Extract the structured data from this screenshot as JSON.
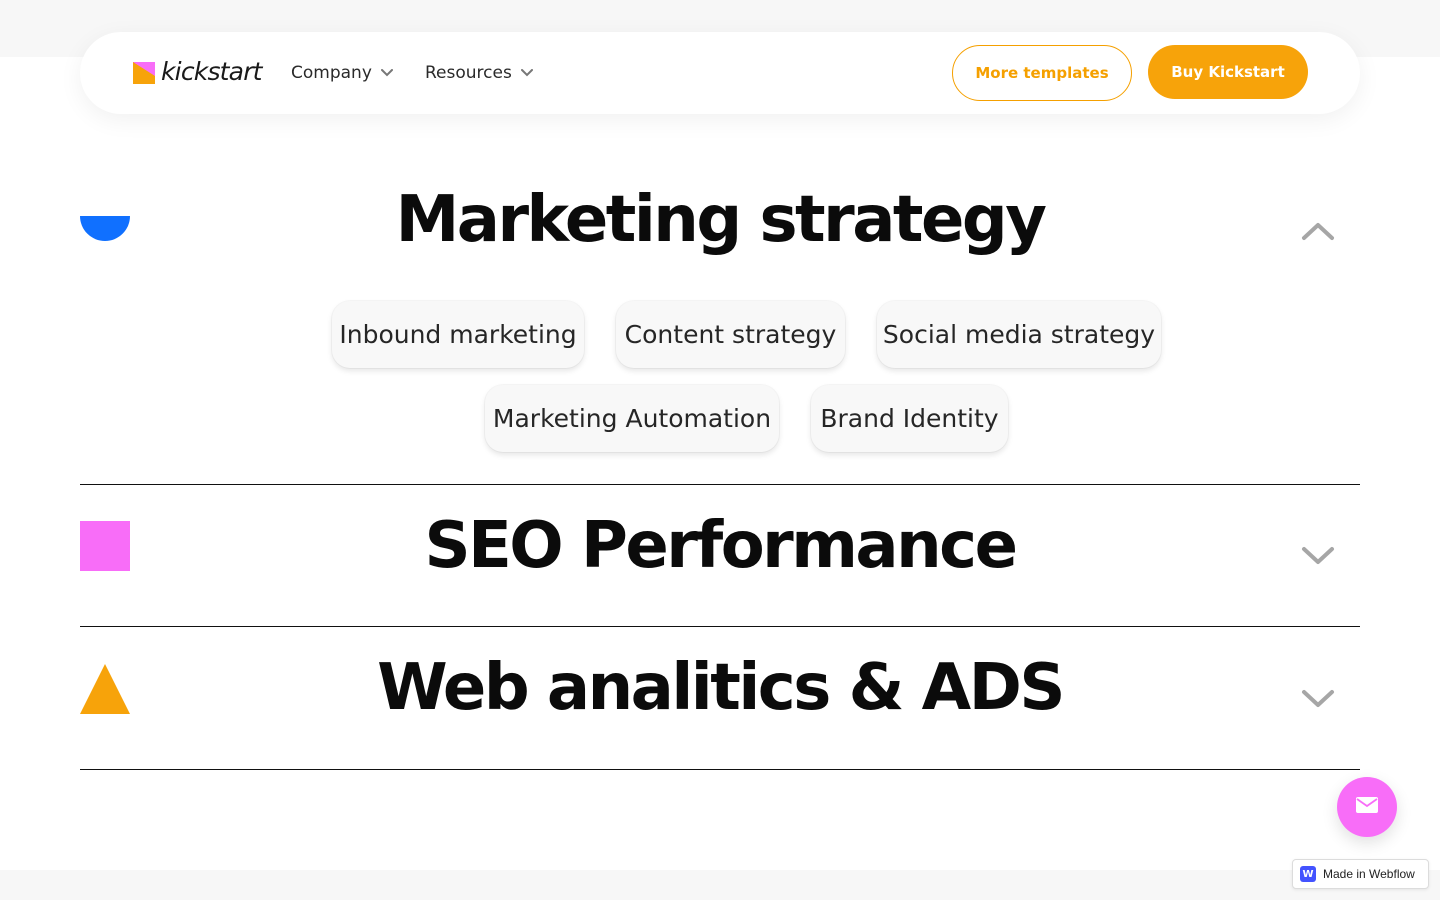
{
  "brand": {
    "name": "kickstart",
    "accent": "#f7a30a",
    "logo_colors": [
      "#f7a30a",
      "#f86df8"
    ]
  },
  "nav": {
    "items": [
      {
        "label": "Company",
        "icon": "chevron-down-icon"
      },
      {
        "label": "Resources",
        "icon": "chevron-down-icon"
      }
    ],
    "more_templates_label": "More templates",
    "buy_label": "Buy Kickstart"
  },
  "accordion": {
    "items": [
      {
        "title": "Marketing strategy",
        "expanded": true,
        "shape": "half-circle",
        "shape_color": "#1070ff",
        "toggle_icon": "chevron-up-icon",
        "tags": [
          "Inbound marketing",
          "Content strategy",
          "Social media strategy",
          "Marketing Automation",
          "Brand Identity"
        ]
      },
      {
        "title": "SEO Performance",
        "expanded": false,
        "shape": "square",
        "shape_color": "#f86df8",
        "toggle_icon": "chevron-down-icon"
      },
      {
        "title": "Web analitics & ADS",
        "expanded": false,
        "shape": "triangle",
        "shape_color": "#f7a30a",
        "toggle_icon": "chevron-down-icon"
      }
    ]
  },
  "fab": {
    "icon": "mail-icon",
    "color": "#f86df8"
  },
  "badge": {
    "label": "Made in Webflow",
    "logo": "W"
  }
}
